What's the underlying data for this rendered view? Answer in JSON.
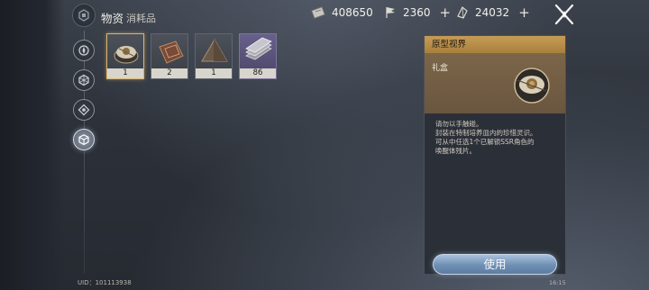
{
  "header": {
    "title": "物资",
    "subtitle": "消耗品"
  },
  "currencies": [
    {
      "icon": "ticket-icon",
      "value": "408650"
    },
    {
      "icon": "flag-icon",
      "value": "2360"
    },
    {
      "icon": "crystal-icon",
      "value": "24032"
    }
  ],
  "nav": {
    "items": [
      "compass-icon",
      "hexagon-icon",
      "diamond-icon",
      "cube-icon"
    ],
    "active_index": 3
  },
  "inventory": {
    "items": [
      {
        "name": "gift-box-item",
        "count": "1",
        "rarity": "normal",
        "selected": true
      },
      {
        "name": "book-item",
        "count": "2",
        "rarity": "normal",
        "selected": false
      },
      {
        "name": "pyramid-item",
        "count": "1",
        "rarity": "normal",
        "selected": false,
        "timed": true
      },
      {
        "name": "bars-item",
        "count": "86",
        "rarity": "purple",
        "selected": false
      }
    ]
  },
  "detail": {
    "title": "原型视界",
    "type": "礼盒",
    "description": [
      "请勿以手触碰。",
      "封装在特制培养皿内的珍惜灵识。",
      "可从中任选1个已解锁SSR角色的",
      "唤醒体残片。"
    ],
    "use_label": "使用"
  },
  "footer": {
    "uid": "UID：101113938",
    "time": "16:15"
  },
  "colors": {
    "accent_gold": "#c69c55",
    "use_button": "#6f8fb3",
    "purple_rarity": "#67608a"
  }
}
